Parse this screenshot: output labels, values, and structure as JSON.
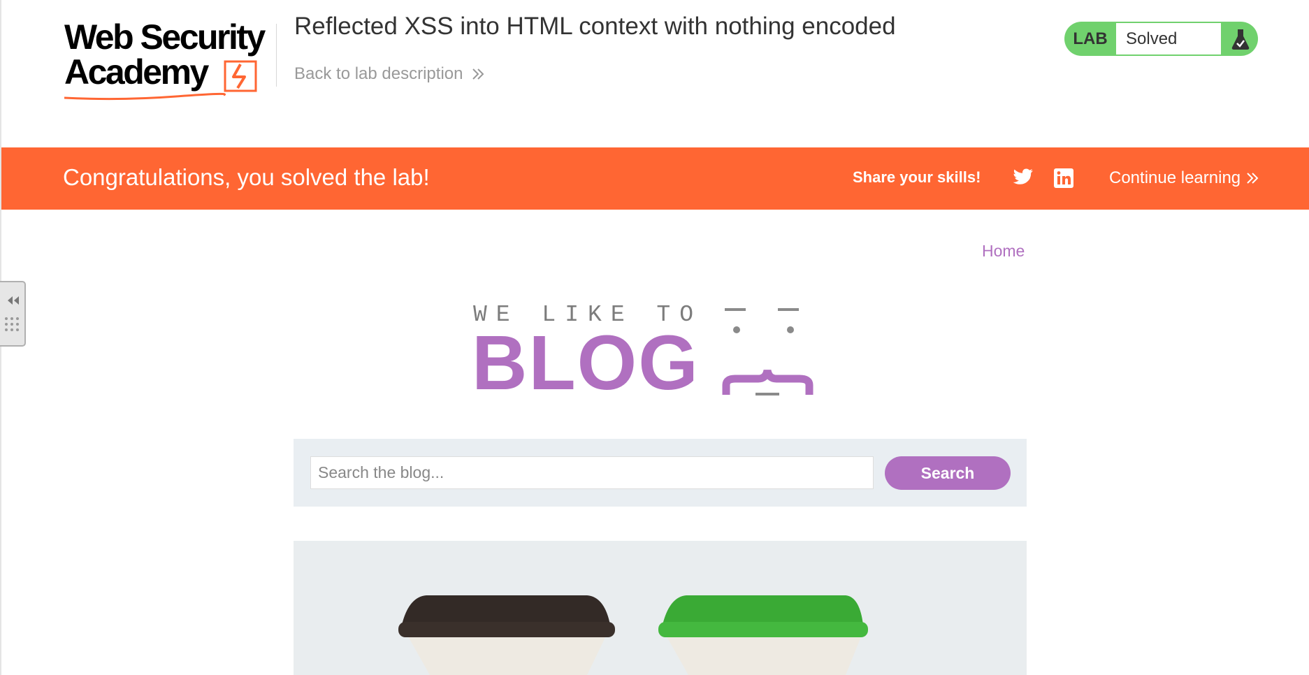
{
  "header": {
    "logo_line1": "Web Security",
    "logo_line2": "Academy",
    "lab_title": "Reflected XSS into HTML context with nothing encoded",
    "back_link": "Back to lab description"
  },
  "status": {
    "badge": "LAB",
    "value": "Solved",
    "icon": "flask-icon",
    "color": "#70d16d"
  },
  "banner": {
    "message": "Congratulations, you solved the lab!",
    "share_label": "Share your skills!",
    "share_icons": [
      "twitter-icon",
      "linkedin-icon"
    ],
    "continue_label": "Continue learning",
    "color": "#ff6633"
  },
  "blog": {
    "nav_home": "Home",
    "logo_top": "WE LIKE TO",
    "logo_main": "BLOG",
    "accent": "#b070c0",
    "search": {
      "placeholder": "Search the blog...",
      "value": "",
      "button": "Search"
    }
  }
}
